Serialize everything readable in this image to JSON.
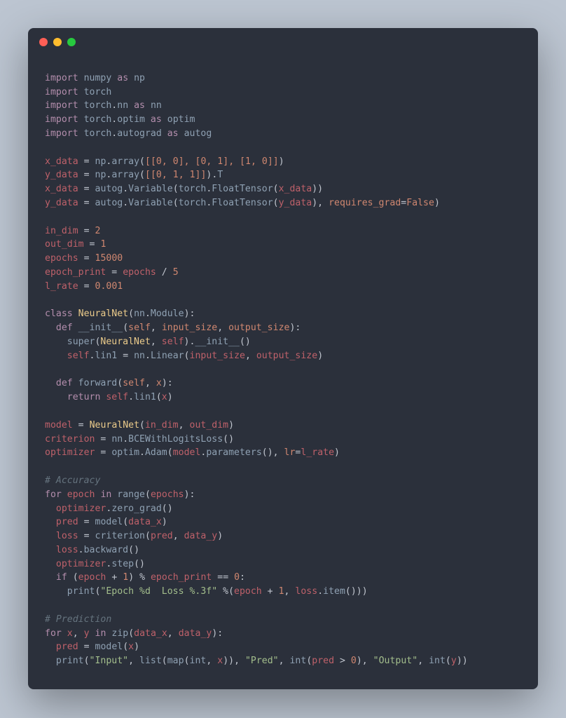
{
  "titlebar": {
    "red": "",
    "yellow": "",
    "green": ""
  },
  "code": {
    "l1": {
      "kw": "import",
      "mod": "numpy",
      "as": "as",
      "alias": "np"
    },
    "l2": {
      "kw": "import",
      "mod": "torch"
    },
    "l3": {
      "kw": "import",
      "m1": "torch",
      "m2": "nn",
      "as": "as",
      "alias": "nn"
    },
    "l4": {
      "kw": "import",
      "m1": "torch",
      "m2": "optim",
      "as": "as",
      "alias": "optim"
    },
    "l5": {
      "kw": "import",
      "m1": "torch",
      "m2": "autograd",
      "as": "as",
      "alias": "autog"
    },
    "l7": {
      "v": "x_data",
      "eq": "=",
      "m": "np",
      "f": "array",
      "lit": "[[0, 0], [0, 1], [1, 0]]"
    },
    "l8": {
      "v": "y_data",
      "eq": "=",
      "m": "np",
      "f": "array",
      "lit": "[[0, 1, 1]]",
      "t": "T"
    },
    "l9": {
      "v": "x_data",
      "eq": "=",
      "m1": "autog",
      "f1": "Variable",
      "m2": "torch",
      "f2": "FloatTensor",
      "arg": "x_data"
    },
    "l10": {
      "v": "y_data",
      "eq": "=",
      "m1": "autog",
      "f1": "Variable",
      "m2": "torch",
      "f2": "FloatTensor",
      "arg": "y_data",
      "kwarg": "requires_grad",
      "val": "False"
    },
    "l12": {
      "v": "in_dim",
      "eq": "=",
      "n": "2"
    },
    "l13": {
      "v": "out_dim",
      "eq": "=",
      "n": "1"
    },
    "l14": {
      "v": "epochs",
      "eq": "=",
      "n": "15000"
    },
    "l15": {
      "v": "epoch_print",
      "eq": "=",
      "r": "epochs",
      "op": "/",
      "n": "5"
    },
    "l16": {
      "v": "l_rate",
      "eq": "=",
      "n": "0.001"
    },
    "l18": {
      "kw": "class",
      "name": "NeuralNet",
      "sup1": "nn",
      "sup2": "Module"
    },
    "l19": {
      "kw": "def",
      "name": "__init__",
      "p1": "self",
      "p2": "input_size",
      "p3": "output_size"
    },
    "l20": {
      "f": "super",
      "a1": "NeuralNet",
      "a2": "self",
      "f2": "__init__"
    },
    "l21": {
      "s": "self",
      "attr": "lin1",
      "eq": "=",
      "m": "nn",
      "f": "Linear",
      "a1": "input_size",
      "a2": "output_size"
    },
    "l23": {
      "kw": "def",
      "name": "forward",
      "p1": "self",
      "p2": "x"
    },
    "l24": {
      "kw": "return",
      "s": "self",
      "f": "lin1",
      "a": "x"
    },
    "l26": {
      "v": "model",
      "eq": "=",
      "cls": "NeuralNet",
      "a1": "in_dim",
      "a2": "out_dim"
    },
    "l27": {
      "v": "criterion",
      "eq": "=",
      "m": "nn",
      "f": "BCEWithLogitsLoss"
    },
    "l28": {
      "v": "optimizer",
      "eq": "=",
      "m": "optim",
      "f": "Adam",
      "a1m": "model",
      "a1f": "parameters",
      "kwarg": "lr",
      "val": "l_rate"
    },
    "l30": {
      "cmt": "# Accuracy"
    },
    "l31": {
      "kw": "for",
      "v": "epoch",
      "in": "in",
      "f": "range",
      "a": "epochs"
    },
    "l32": {
      "m": "optimizer",
      "f": "zero_grad"
    },
    "l33": {
      "v": "pred",
      "eq": "=",
      "f": "model",
      "a": "data_x"
    },
    "l34": {
      "v": "loss",
      "eq": "=",
      "f": "criterion",
      "a1": "pred",
      "a2": "data_y"
    },
    "l35": {
      "m": "loss",
      "f": "backward"
    },
    "l36": {
      "m": "optimizer",
      "f": "step"
    },
    "l37": {
      "kw": "if",
      "lp": "(",
      "v": "epoch",
      "op": "+",
      "n": "1",
      "rp": ")",
      "mod": "%",
      "v2": "epoch_print",
      "eqeq": "==",
      "z": "0"
    },
    "l38": {
      "f": "print",
      "s": "\"Epoch %d  Loss %.3f\"",
      "mod": "%",
      "lp": "(",
      "v": "epoch",
      "op": "+",
      "n": "1",
      "c": ",",
      "m": "loss",
      "f2": "item",
      "rp": ")"
    },
    "l40": {
      "cmt": "# Prediction"
    },
    "l41": {
      "kw": "for",
      "v1": "x",
      "c": ",",
      "v2": "y",
      "in": "in",
      "f": "zip",
      "a1": "data_x",
      "a2": "data_y"
    },
    "l42": {
      "v": "pred",
      "eq": "=",
      "f": "model",
      "a": "x"
    },
    "l43": {
      "f": "print",
      "s1": "\"Input\"",
      "f2": "list",
      "f3": "map",
      "a1": "int",
      "a2": "x",
      "s2": "\"Pred\"",
      "f4": "int",
      "v": "pred",
      "op": ">",
      "n": "0",
      "s3": "\"Output\"",
      "f5": "int",
      "a3": "y"
    }
  }
}
